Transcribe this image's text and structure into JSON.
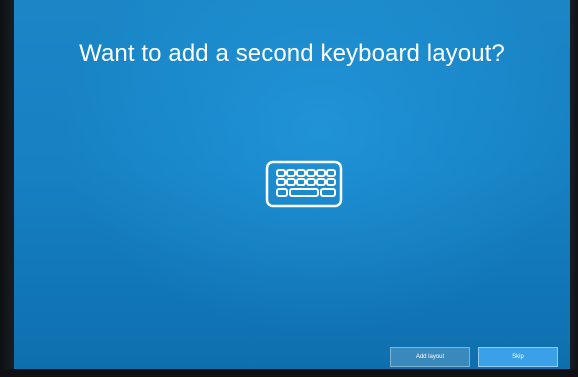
{
  "screen": {
    "title": "Want to add a second keyboard layout?",
    "icon": "keyboard-icon"
  },
  "actions": {
    "add_layout_label": "Add layout",
    "skip_label": "Skip"
  },
  "colors": {
    "background": "#1581c3",
    "primary_button": "#3aa0e8",
    "text": "#ffffff"
  }
}
